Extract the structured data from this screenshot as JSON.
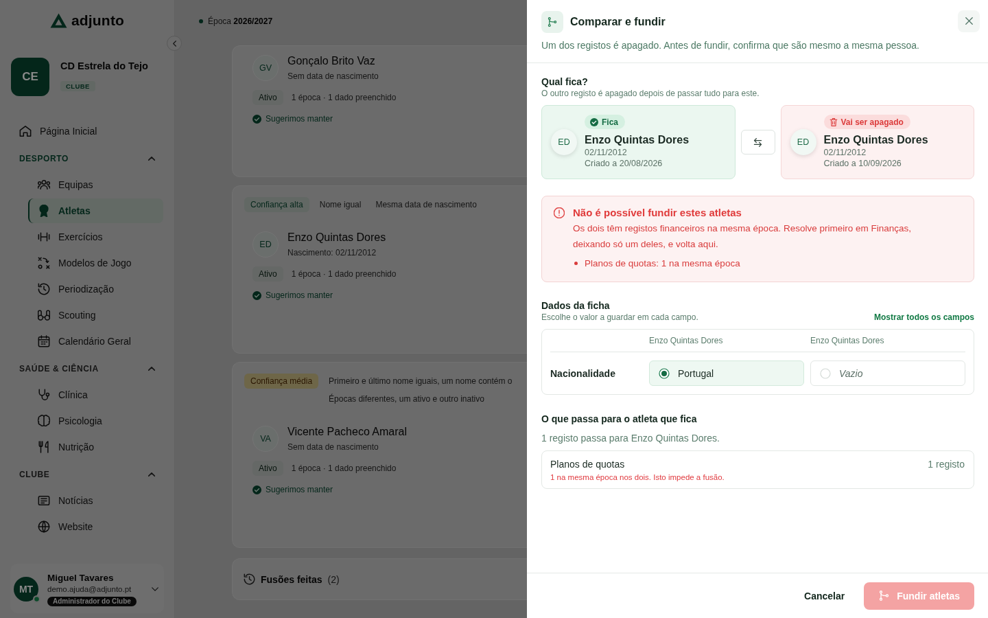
{
  "sidebar": {
    "logo": "adjunto",
    "club": {
      "initials": "CE",
      "name": "CD Estrela do Tejo",
      "type": "CLUBE"
    },
    "home": {
      "label": "Página Inicial",
      "selected": false
    },
    "sections": [
      {
        "title": "DESPORTO",
        "active": true,
        "expanded": true,
        "items": [
          {
            "label": "Equipas",
            "selected": false
          },
          {
            "label": "Atletas",
            "selected": true
          },
          {
            "label": "Exercícios",
            "selected": false
          },
          {
            "label": "Modelos de Jogo",
            "selected": false
          },
          {
            "label": "Periodização",
            "selected": false
          },
          {
            "label": "Scouting",
            "selected": false
          },
          {
            "label": "Calendário Geral",
            "selected": false
          }
        ]
      },
      {
        "title": "SAÚDE & CIÊNCIA",
        "active": false,
        "expanded": true,
        "items": [
          {
            "label": "Clínica",
            "selected": false
          },
          {
            "label": "Psicologia",
            "selected": false
          },
          {
            "label": "Nutrição",
            "selected": false
          }
        ]
      },
      {
        "title": "CLUBE",
        "active": false,
        "expanded": true,
        "items": [
          {
            "label": "Notícias",
            "selected": false
          },
          {
            "label": "Website",
            "selected": false
          }
        ]
      }
    ],
    "user": {
      "initials": "MT",
      "name": "Miguel Tavares",
      "email": "demo.ajuda@adjunto.pt",
      "role": "Administrador do Clube",
      "online": true
    }
  },
  "main": {
    "season": "Época **2026/2027**",
    "cards": [
      {
        "athlete": {
          "initials": "GV",
          "name": "Gonçalo Brito Vaz",
          "birth": "Sem data de nascimento",
          "status": "Ativo",
          "stats": "1 época · 1 dado preenchido",
          "suggestion": "Sugerimos manter"
        }
      },
      {
        "confidence": {
          "label": "Confiança alta",
          "kind": "high"
        },
        "reasons": [
          "Nome igual",
          "Mesma data de nascimento"
        ],
        "athlete": {
          "initials": "ED",
          "name": "Enzo Quintas Dores",
          "birth": "Nascimento: 02/11/2012",
          "status": "Ativo",
          "stats": "1 época · 1 dado preenchido",
          "suggestion": "Sugerimos manter"
        }
      },
      {
        "confidence": {
          "label": "Confiança média",
          "kind": "medium"
        },
        "reasons": [
          "Primeiro e último nome iguais, um nome contém o",
          "Épocas diferentes, um ativo e outro inativo"
        ],
        "athlete": {
          "initials": "VA",
          "name": "Vicente Pacheco Amaral",
          "birth": "Sem data de nascimento",
          "status": "Ativo",
          "stats": "1 época · 1 dado preenchido",
          "suggestion": "Sugerimos manter"
        }
      }
    ],
    "history": {
      "title": "Fusões feitas",
      "count": "(2)"
    }
  },
  "drawer": {
    "title": "Comparar e fundir",
    "subtitle": "Um dos registos é apagado. Antes de fundir, confirma que são mesmo a mesma pessoa.",
    "keep": {
      "title": "Qual fica?",
      "subtitle": "O outro registo é apagado depois de passar tudo para este.",
      "records": [
        {
          "initials": "ED",
          "badge": "Fica",
          "name": "Enzo Quintas Dores",
          "birth": "02/11/2012",
          "created": "Criado a 20/08/2026",
          "selected": true
        },
        {
          "initials": "ED",
          "badge": "Vai ser apagado",
          "name": "Enzo Quintas Dores",
          "birth": "02/11/2012",
          "created": "Criado a 10/09/2026",
          "selected": false
        }
      ]
    },
    "alert": {
      "title": "Não é possível fundir estes atletas",
      "message": "Os dois têm registos financeiros na mesma época. Resolve primeiro em Finanças, deixando só um deles, e volta aqui.",
      "items": [
        "Planos de quotas: 1 na mesma época"
      ]
    },
    "fields": {
      "title": "Dados da ficha",
      "subtitle": "Escolhe o valor a guardar em cada campo.",
      "link": "Mostrar todos os campos",
      "columns": [
        "Enzo Quintas Dores",
        "Enzo Quintas Dores"
      ],
      "rows": [
        {
          "label": "Nacionalidade",
          "options": [
            {
              "value": "Portugal",
              "kind": "value",
              "selected": true
            },
            {
              "value": "Vazio",
              "kind": "empty",
              "selected": false
            }
          ]
        }
      ]
    },
    "transfer": {
      "title": "O que passa para o atleta que fica",
      "summary": "1 registo passa para Enzo Quintas Dores.",
      "items": [
        {
          "name": "Planos de quotas",
          "count": "1 registo",
          "note": "1 na mesma época nos dois. Isto impede a fusão."
        }
      ]
    },
    "footer": {
      "cancel": "Cancelar",
      "submit": "Fundir atletas",
      "submit_disabled": true
    }
  }
}
